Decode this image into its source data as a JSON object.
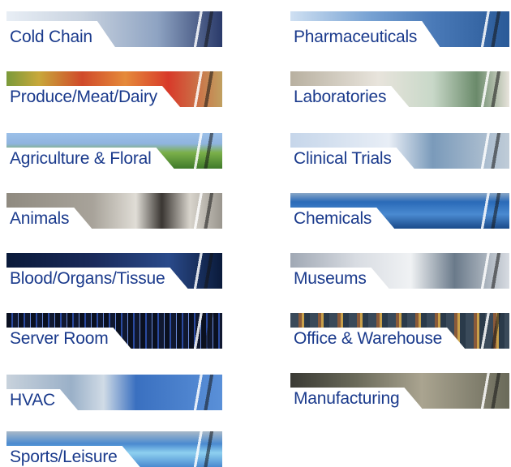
{
  "tiles_left": [
    {
      "label": "Cold Chain",
      "colors": [
        "#c9d3e0",
        "#8ea3c2",
        "#2a3a6a"
      ]
    },
    {
      "label": "Produce/Meat/Dairy",
      "colors": [
        "#7a9a3a",
        "#d04a2a",
        "#e5a43a"
      ]
    },
    {
      "label": "Agriculture & Floral",
      "colors": [
        "#8fb4df",
        "#7bb04a",
        "#3f7a2a"
      ]
    },
    {
      "label": "Animals",
      "colors": [
        "#8f8a80",
        "#d8d4cc",
        "#3a3632"
      ]
    },
    {
      "label": "Blood/Organs/Tissue",
      "colors": [
        "#1a2a5a",
        "#2a4a8a",
        "#0a1a3a"
      ]
    },
    {
      "label": "Server Room",
      "colors": [
        "#0a1020",
        "#2a4aa0",
        "#101830"
      ]
    },
    {
      "label": "HVAC",
      "colors": [
        "#9ab0c8",
        "#d0dbe6",
        "#3a70c0"
      ]
    },
    {
      "label": "Sports/Leisure",
      "colors": [
        "#4a8ad0",
        "#8ed0f0",
        "#ffffff"
      ]
    }
  ],
  "tiles_right": [
    {
      "label": "Pharmaceuticals",
      "colors": [
        "#4a7ab8",
        "#cfe0f2",
        "#2a5a98"
      ]
    },
    {
      "label": "Laboratories",
      "colors": [
        "#b8b0a0",
        "#e8e4dc",
        "#6a8a6a"
      ]
    },
    {
      "label": "Clinical Trials",
      "colors": [
        "#c6d6ea",
        "#7a9aba",
        "#e8eef6"
      ]
    },
    {
      "label": "Chemicals",
      "colors": [
        "#2a6ab8",
        "#4a8ad0",
        "#1a4a8a"
      ]
    },
    {
      "label": "Museums",
      "colors": [
        "#d8dce2",
        "#a0a8b4",
        "#6a7a8a"
      ]
    },
    {
      "label": "Office & Warehouse",
      "colors": [
        "#3a4a5a",
        "#8a5a3a",
        "#c8a04a"
      ]
    },
    {
      "label": "Manufacturing",
      "colors": [
        "#6a6a5a",
        "#aaa490",
        "#3a3a34"
      ]
    }
  ]
}
